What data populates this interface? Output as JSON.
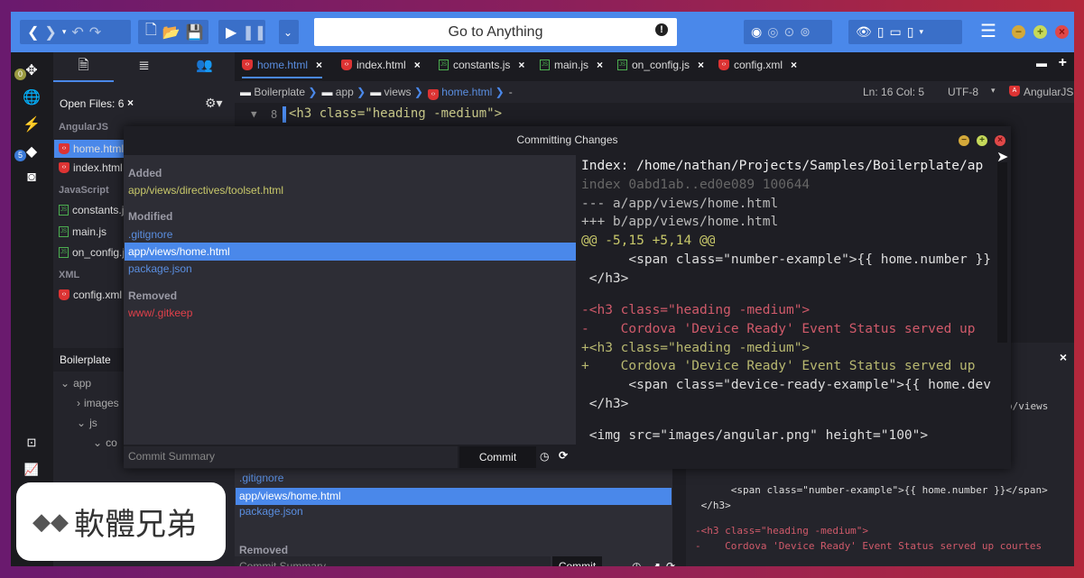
{
  "toolbar": {
    "goto_placeholder": "Go to Anything"
  },
  "sidebar": {
    "open_files_label": "Open Files: 6",
    "badges": {
      "top": "0",
      "git": "5"
    },
    "groups": [
      {
        "name": "AngularJS",
        "files": [
          "home.html",
          "index.html"
        ]
      },
      {
        "name": "JavaScript",
        "files": [
          "constants.js",
          "main.js",
          "on_config.js"
        ]
      },
      {
        "name": "XML",
        "files": [
          "config.xml"
        ]
      }
    ],
    "project": "Boilerplate",
    "tree": [
      "app",
      "images",
      "js",
      "co"
    ]
  },
  "tabs": [
    {
      "label": "home.html",
      "type": "html",
      "active": true
    },
    {
      "label": "index.html",
      "type": "html"
    },
    {
      "label": "constants.js",
      "type": "js"
    },
    {
      "label": "main.js",
      "type": "js"
    },
    {
      "label": "on_config.js",
      "type": "js"
    },
    {
      "label": "config.xml",
      "type": "xml"
    }
  ],
  "breadcrumb": [
    "Boilerplate",
    "app",
    "views",
    "home.html",
    "-"
  ],
  "status": {
    "position": "Ln: 16 Col: 5",
    "encoding": "UTF-8",
    "language": "AngularJS"
  },
  "editor": {
    "line_number": "8",
    "line": "<h3 class=\"heading -medium\">"
  },
  "dialog": {
    "title": "Committing Changes",
    "added_label": "Added",
    "added": [
      "app/views/directives/toolset.html"
    ],
    "modified_label": "Modified",
    "modified": [
      ".gitignore",
      "app/views/home.html",
      "package.json"
    ],
    "removed_label": "Removed",
    "removed": [
      "www/.gitkeep"
    ],
    "summary_placeholder": "Commit Summary",
    "commit_label": "Commit",
    "diff": [
      {
        "t": "Index: /home/nathan/Projects/Samples/Boilerplate/ap",
        "k": "head"
      },
      {
        "t": "index 0abd1ab..ed0e089 100644",
        "k": "meta"
      },
      {
        "t": "--- a/app/views/home.html",
        "k": "file"
      },
      {
        "t": "+++ b/app/views/home.html",
        "k": "file"
      },
      {
        "t": "@@ -5,15 +5,14 @@",
        "k": "hunk"
      },
      {
        "t": "      <span class=\"number-example\">{{ home.number }}",
        "k": "ctx"
      },
      {
        "t": " </h3>",
        "k": "ctx"
      },
      {
        "t": "",
        "k": "ctx"
      },
      {
        "t": "-<h3 class=\"heading -medium\">",
        "k": "del"
      },
      {
        "t": "-    Cordova 'Device Ready' Event Status served up",
        "k": "del"
      },
      {
        "t": "+<h3 class=\"heading -medium\">",
        "k": "add"
      },
      {
        "t": "+    Cordova 'Device Ready' Event Status served up",
        "k": "add"
      },
      {
        "t": "      <span class=\"device-ready-example\">{{ home.dev",
        "k": "ctx"
      },
      {
        "t": " </h3>",
        "k": "ctx"
      },
      {
        "t": "",
        "k": "ctx"
      },
      {
        "t": " <img src=\"images/angular.png\" height=\"100\">",
        "k": "ctx"
      }
    ]
  },
  "background_panel": {
    "modified": [
      ".gitignore",
      "app/views/home.html",
      "package.json"
    ],
    "removed_label": "Removed",
    "summary_placeholder": "Commit Summary",
    "commit_label": "Commit",
    "path_fragment": "p/views",
    "diff": [
      {
        "t": "      <span class=\"number-example\">{{ home.number }}</span>",
        "k": "ctx"
      },
      {
        "t": " </h3>",
        "k": "ctx"
      },
      {
        "t": "",
        "k": "ctx"
      },
      {
        "t": "-<h3 class=\"heading -medium\">",
        "k": "del"
      },
      {
        "t": "-    Cordova 'Device Ready' Event Status served up courtes",
        "k": "del"
      }
    ]
  },
  "watermark": {
    "text": "軟體兄弟"
  },
  "colors": {
    "accent": "#4a88ea",
    "added": "#c8c86a",
    "modified": "#5a8ee0",
    "removed": "#e0404a",
    "diff_del": "#d05a6a",
    "diff_add": "#b8b870"
  }
}
